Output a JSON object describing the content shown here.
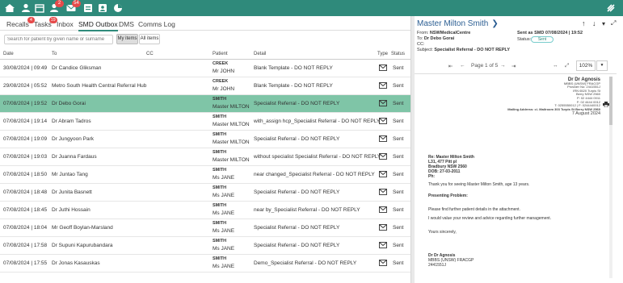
{
  "topbar": {
    "icons": [
      {
        "name": "home-icon"
      },
      {
        "name": "contacts-icon"
      },
      {
        "name": "calendar-icon"
      },
      {
        "name": "patients-icon",
        "badge": "2"
      },
      {
        "name": "messages-icon",
        "badge": "54"
      },
      {
        "name": "inbox-icon"
      },
      {
        "name": "profile-icon"
      },
      {
        "name": "reports-icon"
      }
    ],
    "brand_icon": "brand-logo-icon"
  },
  "tabs": [
    {
      "label": "Recalls",
      "badge": "4"
    },
    {
      "label": "Tasks",
      "badge": "19"
    },
    {
      "label": "Inbox",
      "badge": ""
    },
    {
      "label": "SMD Outbox",
      "badge": "",
      "active": true
    },
    {
      "label": "DMS",
      "badge": ""
    },
    {
      "label": "Comms Log",
      "badge": ""
    }
  ],
  "search": {
    "placeholder": "Search for patient by given name or surname"
  },
  "filters": {
    "my_items": "My items",
    "all_items": "All items"
  },
  "table": {
    "headers": {
      "date": "Date",
      "to": "To",
      "cc": "CC",
      "patient": "Patient",
      "detail": "Detail",
      "type": "Type",
      "status": "Status"
    },
    "rows": [
      {
        "date": "30/08/2024 | 09:49",
        "to": "Dr Candice Gliksman",
        "patient_last": "CREEK",
        "patient_first": "Mr JOHN",
        "detail": "Blank Template - DO NOT REPLY",
        "status": "Sent"
      },
      {
        "date": "29/08/2024 | 05:52",
        "to": "Metro South Health Central Referral Hub",
        "patient_last": "CREEK",
        "patient_first": "Mr JOHN",
        "detail": "Blank Template - DO NOT REPLY",
        "status": "Sent"
      },
      {
        "date": "07/08/2024 | 19:52",
        "to": "Dr Debo Gorai",
        "patient_last": "SMITH",
        "patient_first": "Master MILTON",
        "detail": "Specialist Referral - DO NOT REPLY",
        "status": "Sent",
        "selected": true
      },
      {
        "date": "07/08/2024 | 19:14",
        "to": "Dr Abram Tadros",
        "patient_last": "SMITH",
        "patient_first": "Master MILTON",
        "detail": "with_assign hcp_Specialist Referral - DO NOT REPLY",
        "status": "Sent"
      },
      {
        "date": "07/08/2024 | 19:09",
        "to": "Dr Jungyoon Park",
        "patient_last": "SMITH",
        "patient_first": "Master MILTON",
        "detail": "Specialist Referral - DO NOT REPLY",
        "status": "Sent"
      },
      {
        "date": "07/08/2024 | 19:03",
        "to": "Dr Juanna Fardaus",
        "patient_last": "SMITH",
        "patient_first": "Master MILTON",
        "detail": "without specialist Specialist Referral - DO NOT REPLY",
        "status": "Sent"
      },
      {
        "date": "07/08/2024 | 18:50",
        "to": "Mr Juntao Tang",
        "patient_last": "SMITH",
        "patient_first": "Ms JANE",
        "detail": "near changed_Specialist Referral - DO NOT REPLY",
        "status": "Sent"
      },
      {
        "date": "07/08/2024 | 18:48",
        "to": "Dr Junita Basnett",
        "patient_last": "SMITH",
        "patient_first": "Ms JANE",
        "detail": "Specialist Referral - DO NOT REPLY",
        "status": "Sent"
      },
      {
        "date": "07/08/2024 | 18:45",
        "to": "Dr Juthi Hossain",
        "patient_last": "SMITH",
        "patient_first": "Ms JANE",
        "detail": "near by_Specialist Referral - DO NOT REPLY",
        "status": "Sent"
      },
      {
        "date": "07/08/2024 | 18:04",
        "to": "Mr Geoff Boylan-Marsland",
        "patient_last": "SMITH",
        "patient_first": "Ms JANE",
        "detail": "Specialist Referral - DO NOT REPLY",
        "status": "Sent"
      },
      {
        "date": "07/08/2024 | 17:58",
        "to": "Dr Supuni Kapurubandara",
        "patient_last": "SMITH",
        "patient_first": "Ms JANE",
        "detail": "Specialist Referral - DO NOT REPLY",
        "status": "Sent"
      },
      {
        "date": "07/08/2024 | 17:55",
        "to": "Dr Jonas Kasauskas",
        "patient_last": "SMITH",
        "patient_first": "Ms JANE",
        "detail": "Demo_Specialist Referral - DO NOT REPLY",
        "status": "Sent"
      }
    ]
  },
  "detail": {
    "title": "Master Milton Smith",
    "from_label": "From:",
    "from": "NSWMedicalCentre",
    "to_label": "To:",
    "to": "Dr Debo Gorai",
    "cc_label": "CC:",
    "subject_label": "Subject:",
    "subject": "Specialist Referral - DO NOT REPLY",
    "sent_as": "Sent as SMD 07/08/2024 | 19:52",
    "status_label": "Status:",
    "status": "Sent"
  },
  "pdf": {
    "page_label": "Page 1 of 5",
    "zoom": "102%"
  },
  "letter": {
    "letterhead": {
      "name": "Dr Dr Agnosis",
      "lines": [
        "MBBS (UNSW) FRACGP",
        "Provider No: 2441551J",
        "IRN 6520 Turpis St",
        "Berry NSW 2560",
        "P: 02 4444 0011",
        "F: 02 4444 0012",
        "T: 0255550012 | F: 0244440012",
        "Mailing Address: c/- Mailroom 303 Turpis St Berry NSW 2560"
      ],
      "date": "7 August 2024"
    },
    "re": "Re: Master Milton Smith",
    "address1": "L31, 477 Pitt pl",
    "address2": "Bradbury NSW 2560",
    "dob": "DOB: 27-03-2011",
    "ph": "Ph:",
    "body1": "Thank you for seeing Master Milton Smith, age 13 years.",
    "presenting": "Presenting Problem:",
    "body2": "Please find further patient details in the attachment.",
    "body3": "I would value your review and advice regarding further management.",
    "closing": "Yours sincerely,",
    "sig_name": "Dr Dr Agnosis",
    "sig_qual": "MBBS (UNSW) FRACGP",
    "sig_prov": "2441551J"
  },
  "colors": {
    "accent": "#2f8a7b",
    "selected_row": "#7fc5a7",
    "title_blue": "#2a5d92",
    "badge_red": "#e64a4a"
  }
}
